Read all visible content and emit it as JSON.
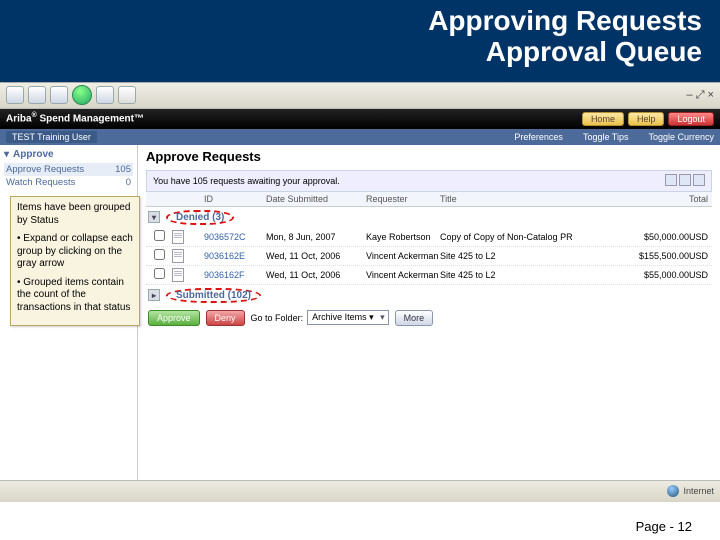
{
  "header": {
    "title_l1": "Approving Requests",
    "title_l2": "Approval Queue"
  },
  "browser": {
    "win_ctrl": "–  ⤢  ×"
  },
  "ariba": {
    "product_html": "Ariba",
    "product_suffix": "Spend Management™",
    "btn_home": "Home",
    "btn_help": "Help",
    "btn_logout": "Logout"
  },
  "nav": {
    "user": "TEST Training User",
    "pref": "Preferences",
    "tips": "Toggle Tips",
    "curr": "Toggle Currency"
  },
  "sidebar": {
    "heading": "Approve",
    "rows": [
      {
        "label": "Approve Requests",
        "count": "105"
      },
      {
        "label": "Watch Requests",
        "count": "0"
      }
    ]
  },
  "main": {
    "h2": "Approve Requests",
    "await_msg": "You have 105 requests awaiting your approval.",
    "cols": {
      "id": "ID",
      "date": "Date Submitted",
      "req": "Requester",
      "title": "Title",
      "total": "Total"
    },
    "group_denied": "Denied (3)",
    "group_submitted": "Submitted (102)",
    "rows": [
      {
        "id": "9036572C",
        "date": "Mon, 8 Jun, 2007",
        "req": "Kaye Robertson",
        "title": "Copy of Copy of Non-Catalog PR",
        "total": "$50,000.00USD"
      },
      {
        "id": "9036162E",
        "date": "Wed, 11 Oct, 2006",
        "req": "Vincent Ackerman",
        "title": "Site 425 to L2",
        "total": "$155,500.00USD"
      },
      {
        "id": "9036162F",
        "date": "Wed, 11 Oct, 2006",
        "req": "Vincent Ackerman",
        "title": "Site 425 to L2",
        "total": "$55,000.00USD"
      }
    ],
    "actions": {
      "approve": "Approve",
      "deny": "Deny",
      "goto_label": "Go to Folder:",
      "goto_value": "Archive Items ▾",
      "more": "More"
    }
  },
  "status": {
    "net": "Internet"
  },
  "callout": {
    "p1": "Items have been grouped by Status",
    "p2": "• Expand or collapse each group by clicking on the gray arrow",
    "p3": "• Grouped items contain the count of the transactions in that status"
  },
  "footer": {
    "page": "Page - 12"
  }
}
